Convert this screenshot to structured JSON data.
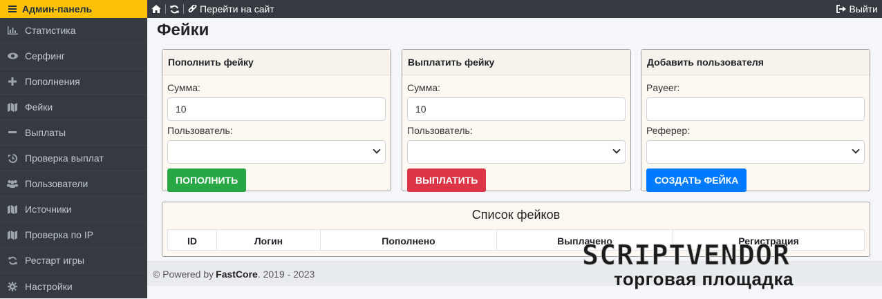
{
  "sidebar": {
    "brand": "Админ-панель",
    "items": [
      {
        "label": "Статистика",
        "icon": "chart-icon"
      },
      {
        "label": "Серфинг",
        "icon": "eye-icon"
      },
      {
        "label": "Пополнения",
        "icon": "plus-icon"
      },
      {
        "label": "Фейки",
        "icon": "map-icon"
      },
      {
        "label": "Выплаты",
        "icon": "minus-icon"
      },
      {
        "label": "Проверка выплат",
        "icon": "history-icon"
      },
      {
        "label": "Пользователи",
        "icon": "users-icon"
      },
      {
        "label": "Источники",
        "icon": "map-icon"
      },
      {
        "label": "Проверка по IP",
        "icon": "map-icon"
      },
      {
        "label": "Рестарт игры",
        "icon": "refresh-icon"
      },
      {
        "label": "Настройки",
        "icon": "gear-icon"
      }
    ]
  },
  "topbar": {
    "site_link": "Перейти на сайт",
    "logout": "Выйти"
  },
  "page": {
    "title": "Фейки"
  },
  "cards": {
    "deposit": {
      "title": "Пополнить фейку",
      "amount_label": "Сумма:",
      "amount_value": "10",
      "user_label": "Пользователь:",
      "button": "ПОПОЛНИТЬ"
    },
    "payout": {
      "title": "Выплатить фейку",
      "amount_label": "Сумма:",
      "amount_value": "10",
      "user_label": "Пользователь:",
      "button": "ВЫПЛАТИТЬ"
    },
    "add_user": {
      "title": "Добавить пользователя",
      "payeer_label": "Payeer:",
      "payeer_value": "",
      "referrer_label": "Реферер:",
      "button": "СОЗДАТЬ ФЕЙКА"
    }
  },
  "fakes_list": {
    "title": "Список фейков",
    "columns": [
      "ID",
      "Логин",
      "Пополнено",
      "Выплачено",
      "Регистрация"
    ]
  },
  "footer": {
    "prefix": "© Powered by",
    "brand": "FastCore",
    "years": ". 2019 - 2023"
  },
  "watermark": {
    "top": "SCRIPTVENDOR",
    "bottom": "торговая площадка"
  },
  "colors": {
    "sidebar": "#343a40",
    "brand": "#ffc107",
    "deposit_button": "#28a745",
    "payout_button": "#dc3545",
    "create_button": "#007bff",
    "card_bg": "#fdf8f1"
  }
}
